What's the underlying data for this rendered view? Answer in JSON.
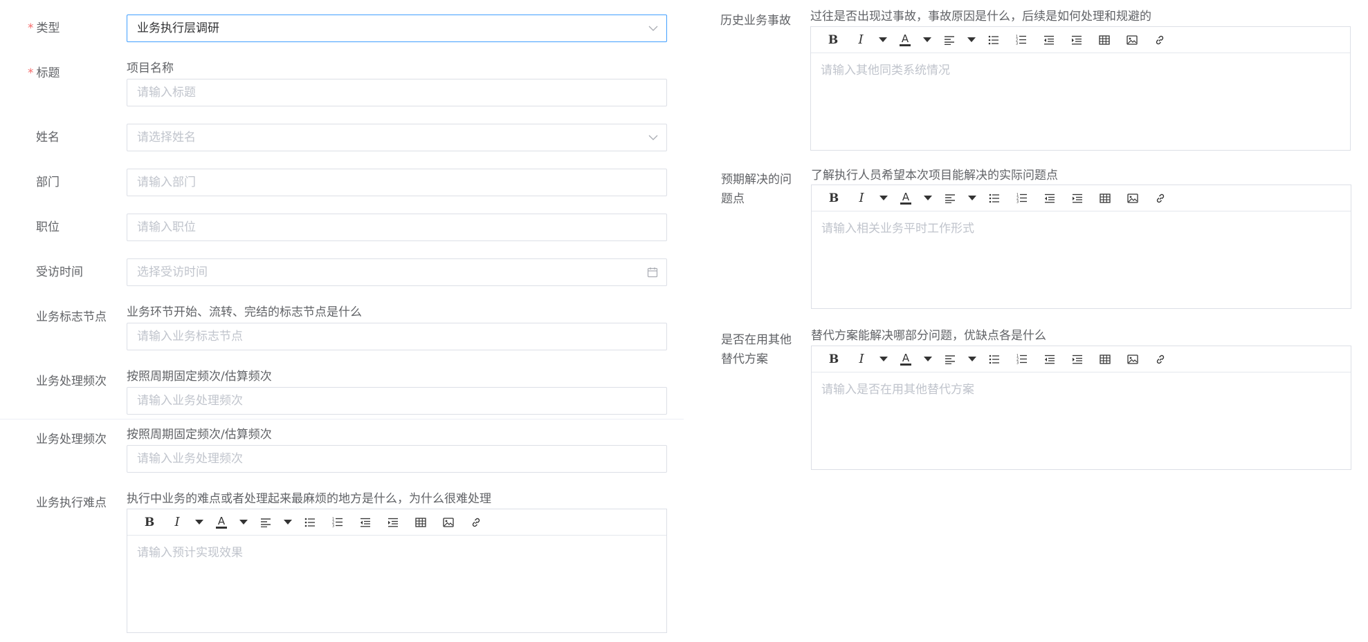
{
  "left": {
    "type": {
      "label": "类型",
      "value": "业务执行层调研"
    },
    "title": {
      "label": "标题",
      "hint": "项目名称",
      "placeholder": "请输入标题"
    },
    "name": {
      "label": "姓名",
      "placeholder": "请选择姓名"
    },
    "dept": {
      "label": "部门",
      "placeholder": "请输入部门"
    },
    "position": {
      "label": "职位",
      "placeholder": "请输入职位"
    },
    "visit_time": {
      "label": "受访时间",
      "placeholder": "选择受访时间"
    },
    "milestone": {
      "label": "业务标志节点",
      "hint": "业务环节开始、流转、完结的标志节点是什么",
      "placeholder": "请输入业务标志节点"
    },
    "freq1": {
      "label": "业务处理频次",
      "hint": "按照周期固定频次/估算频次",
      "placeholder": "请输入业务处理频次"
    },
    "freq2": {
      "label": "业务处理频次",
      "hint": "按照周期固定频次/估算频次",
      "placeholder": "请输入业务处理频次"
    },
    "difficulty": {
      "label": "业务执行难点",
      "hint": "执行中业务的难点或者处理起来最麻烦的地方是什么，为什么很难处理",
      "placeholder": "请输入预计实现效果"
    }
  },
  "right": {
    "accident": {
      "label": "历史业务事故",
      "hint": "过往是否出现过事故，事故原因是什么，后续是如何处理和规避的",
      "placeholder": "请输入其他同类系统情况"
    },
    "expected": {
      "label_line1": "预期解决的问",
      "label_line2": "题点",
      "hint": "了解执行人员希望本次项目能解决的实际问题点",
      "placeholder": "请输入相关业务平时工作形式"
    },
    "alternative": {
      "label_line1": "是否在用其他",
      "label_line2": "替代方案",
      "hint": "替代方案能解决哪部分问题，优缺点各是什么",
      "placeholder": "请输入是否在用其他替代方案"
    }
  },
  "toolbar": {
    "bold": "B",
    "italic": "I",
    "font_color": "A"
  },
  "colors": {
    "required": "#f56c6c",
    "focus_border": "#409eff",
    "border": "#dcdfe6",
    "placeholder": "#c0c4cc"
  }
}
